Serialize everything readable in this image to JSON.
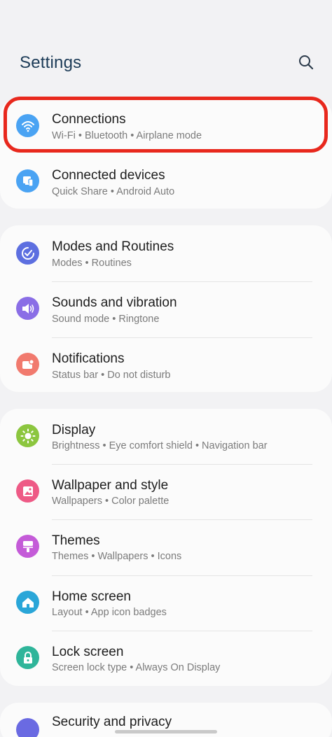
{
  "header": {
    "title": "Settings",
    "search_icon": "search-icon"
  },
  "colors": {
    "accent_highlight": "#e8281d",
    "connections": "#4aa3f3",
    "connected_devices": "#4aa3f3",
    "modes": "#5d6fe0",
    "sounds": "#8a6ee6",
    "notifications": "#f17a6e",
    "display": "#8cc63f",
    "wallpaper": "#ee5a86",
    "themes": "#c45bd8",
    "home": "#2aa6d8",
    "lock": "#2fb59a",
    "security": "#6a6ae2"
  },
  "groups": [
    {
      "items": [
        {
          "title": "Connections",
          "subtitle": "Wi-Fi  •  Bluetooth  •  Airplane mode",
          "icon": "wifi-icon"
        },
        {
          "title": "Connected devices",
          "subtitle": "Quick Share  •  Android Auto",
          "icon": "connected-devices-icon"
        }
      ]
    },
    {
      "items": [
        {
          "title": "Modes and Routines",
          "subtitle": "Modes  •  Routines",
          "icon": "modes-check-icon"
        },
        {
          "title": "Sounds and vibration",
          "subtitle": "Sound mode  •  Ringtone",
          "icon": "speaker-icon"
        },
        {
          "title": "Notifications",
          "subtitle": "Status bar  •  Do not disturb",
          "icon": "notification-badge-icon"
        }
      ]
    },
    {
      "items": [
        {
          "title": "Display",
          "subtitle": "Brightness  •  Eye comfort shield  •  Navigation bar",
          "icon": "sun-icon"
        },
        {
          "title": "Wallpaper and style",
          "subtitle": "Wallpapers  •  Color palette",
          "icon": "image-icon"
        },
        {
          "title": "Themes",
          "subtitle": "Themes  •  Wallpapers  •  Icons",
          "icon": "paintbrush-icon"
        },
        {
          "title": "Home screen",
          "subtitle": "Layout  •  App icon badges",
          "icon": "home-icon"
        },
        {
          "title": "Lock screen",
          "subtitle": "Screen lock type  •  Always On Display",
          "icon": "lock-icon"
        }
      ]
    },
    {
      "items": [
        {
          "title": "Security and privacy",
          "icon": "shield-icon"
        }
      ]
    }
  ]
}
